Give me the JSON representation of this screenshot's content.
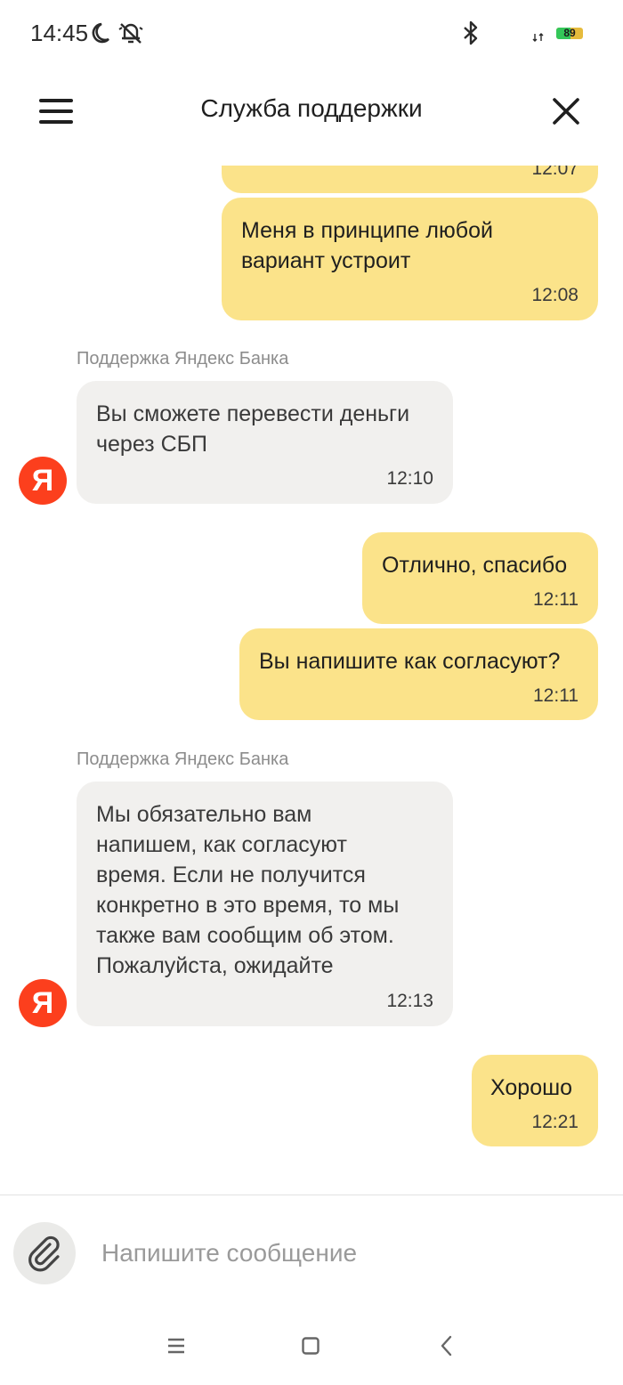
{
  "status": {
    "time": "14:45",
    "battery": "89",
    "battery_level": 0.89,
    "icons": [
      "moon-icon",
      "bell-off-icon",
      "bluetooth-icon",
      "signal-icon",
      "battery-icon"
    ]
  },
  "header": {
    "title": "Служба поддержки",
    "menu_icon": "menu-icon",
    "close_icon": "close-icon"
  },
  "messages": [
    {
      "from": "user",
      "text": "",
      "time": "12:07"
    },
    {
      "from": "user",
      "text": "Меня в принципе любой\nвариант устроит",
      "time": "12:08"
    },
    {
      "from": "support",
      "sender": "Поддержка Яндекс Банка",
      "avatar": "Я",
      "text": "Вы сможете перевести деньги\nчерез СБП",
      "time": "12:10"
    },
    {
      "from": "user",
      "text": "Отлично, спасибо",
      "time": "12:11"
    },
    {
      "from": "user",
      "text": "Вы напишите как согласуют?",
      "time": "12:11"
    },
    {
      "from": "support",
      "sender": "Поддержка Яндекс Банка",
      "avatar": "Я",
      "text": "Мы обязательно вам\nнапишем, как согласуют\nвремя. Если не получится\nконкретно в это время, то мы\nтакже вам сообщим об этом.\nПожалуйста, ожидайте",
      "time": "12:13"
    },
    {
      "from": "user",
      "text": "Хорошо",
      "time": "12:21"
    }
  ],
  "composer": {
    "placeholder": "Напишите сообщение",
    "value": "",
    "attach_icon": "paperclip-icon"
  },
  "navbar": {
    "icons": [
      "recents-icon",
      "home-icon",
      "back-icon"
    ]
  },
  "colors": {
    "user_bubble": "#fbe38a",
    "support_bubble": "#f1f0ee",
    "avatar": "#fc3f1d"
  }
}
